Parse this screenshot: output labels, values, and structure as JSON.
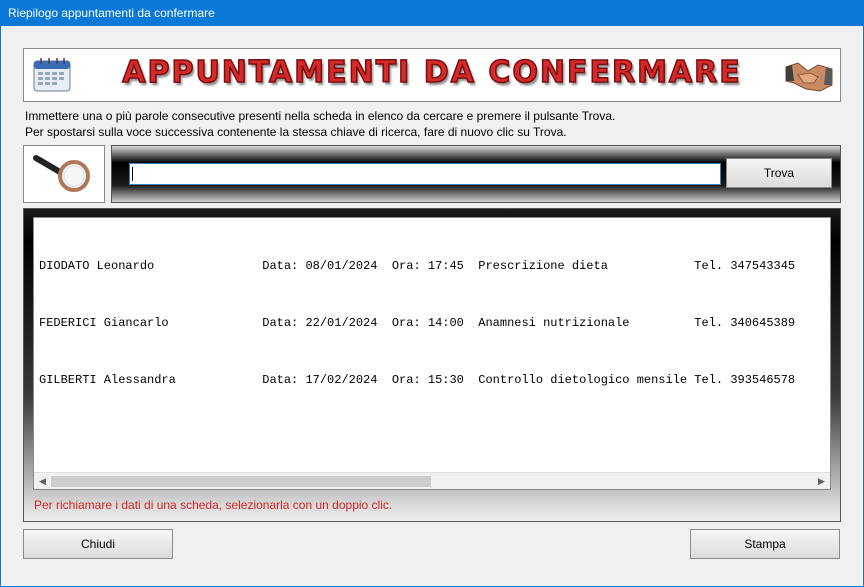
{
  "window": {
    "title": "Riepilogo appuntamenti da confermare"
  },
  "banner": {
    "title": "APPUNTAMENTI DA CONFERMARE"
  },
  "instructions": {
    "line1": "Immettere una o più parole consecutive presenti nella scheda in elenco da cercare e premere il pulsante Trova.",
    "line2": "Per spostarsi sulla voce successiva contenente la stessa chiave di ricerca, fare di nuovo clic su Trova."
  },
  "search": {
    "value": "",
    "button_label": "Trova"
  },
  "list": {
    "rows": [
      {
        "text": "DIODATO Leonardo               Data: 08/01/2024  Ora: 17:45  Prescrizione dieta            Tel. 347543345"
      },
      {
        "text": "FEDERICI Giancarlo             Data: 22/01/2024  Ora: 14:00  Anamnesi nutrizionale         Tel. 340645389"
      },
      {
        "text": "GILBERTI Alessandra            Data: 17/02/2024  Ora: 15:30  Controllo dietologico mensile Tel. 393546578"
      }
    ],
    "hint": "Per richiamare i dati di una scheda, selezionarla con un doppio clic."
  },
  "footer": {
    "close_label": "Chiudi",
    "print_label": "Stampa"
  },
  "colors": {
    "titlebar": "#0a78d7",
    "banner_text": "#d62a2a",
    "hint_text": "#d42424"
  },
  "icons": {
    "banner_left": "calendar-icon",
    "banner_right": "handshake-icon",
    "search": "magnifier-icon"
  }
}
